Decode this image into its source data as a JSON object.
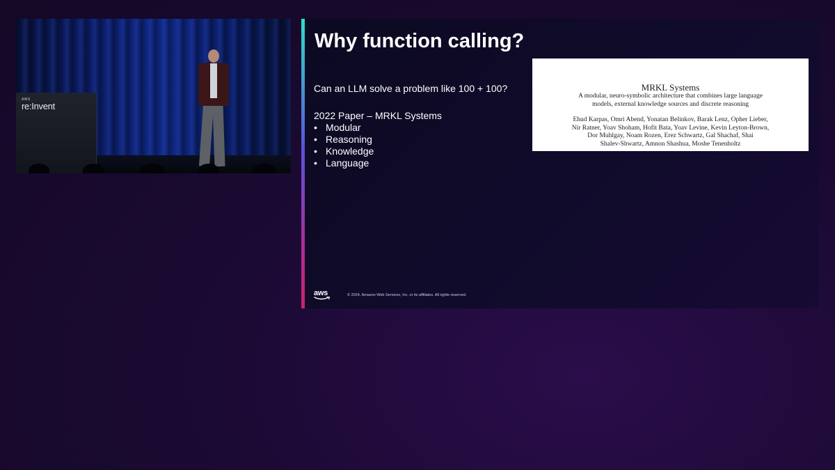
{
  "video": {
    "podium_logo_small": "AWS",
    "podium_logo": "re:Invent"
  },
  "slide": {
    "title": "Why function calling?",
    "question": "Can an LLM solve a problem like 100 + 100?",
    "paper_heading": "2022 Paper – MRKL Systems",
    "bullet_glyph": "•",
    "bullets": [
      "Modular",
      "Reasoning",
      "Knowledge",
      "Language"
    ],
    "paper_excerpt": {
      "title": "MRKL Systems",
      "subtitle": "A modular, neuro-symbolic architecture that combines large language\nmodels, external knowledge sources and discrete reasoning",
      "authors": "Ehud Karpas, Omri Abend, Yonatan Belinkov, Barak Lenz, Opher Lieber,\nNir Ratner, Yoav Shoham, Hofit Bata, Yoav Levine, Kevin Leyton-Brown,\nDor Muhlgay, Noam Rozen, Erez Schwartz, Gal Shachaf, Shai\nShalev-Shwartz, Amnon Shashua, Moshe Tenenholtz"
    },
    "footer": {
      "logo_text": "aws",
      "copyright": "© 2024, Amazon Web Services, Inc. or its affiliates. All rights reserved."
    }
  },
  "colors": {
    "background": "#1b0a33",
    "slide_background": "#100b2b",
    "accent_gradient": [
      "#2de0c8",
      "#5a52d8",
      "#b8288a",
      "#c8246a"
    ],
    "aws_smile": "#ffffff"
  }
}
